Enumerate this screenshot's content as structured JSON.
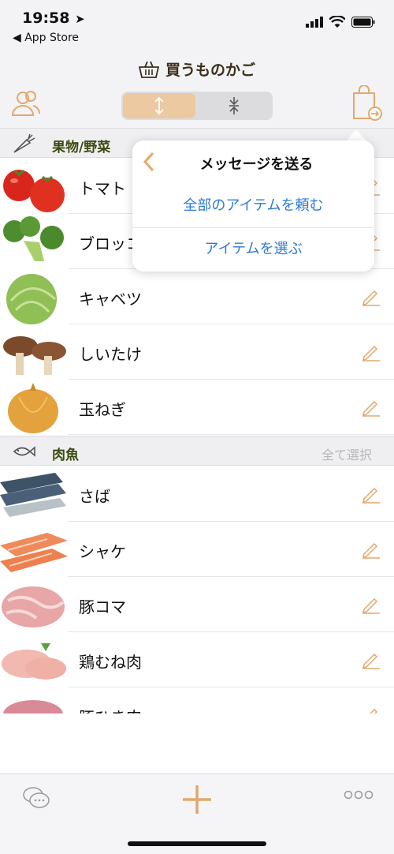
{
  "status": {
    "time": "19:58",
    "back_app": "◀ App Store"
  },
  "nav": {
    "title": "買うものかご"
  },
  "sections": [
    {
      "title": "果物/野菜"
    },
    {
      "title": "肉魚",
      "select_all": "全て選択"
    }
  ],
  "items_produce": [
    "トマト",
    "ブロッコ",
    "キャベツ",
    "しいたけ",
    "玉ねぎ"
  ],
  "items_meat": [
    "さば",
    "シャケ",
    "豚コマ",
    "鶏むね肉",
    "豚ひき肉"
  ],
  "popover": {
    "title": "メッセージを送る",
    "options": [
      "全部のアイテムを頼む",
      "アイテムを選ぶ"
    ]
  },
  "icons": {
    "nav": "basket-icon",
    "left": "people-icon",
    "right": "shopping-bag-send-icon",
    "segment_a": "expand-vertical-icon",
    "segment_b": "collapse-vertical-icon",
    "row": "pencil-icon",
    "tabs": [
      "chat-icon",
      "plus-icon",
      "more-icon"
    ]
  },
  "colors": {
    "accent": "#e3a86a",
    "link": "#2e7ad6",
    "section": "#3a4b10"
  }
}
